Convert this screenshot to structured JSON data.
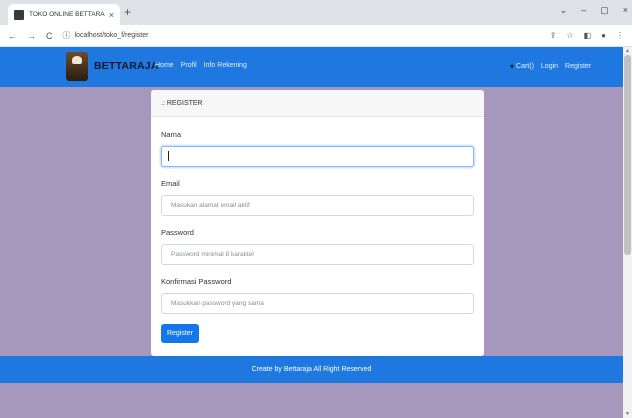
{
  "browser": {
    "tab_title": "TOKO ONLINE BETTARAJA",
    "tab_close": "×",
    "new_tab": "+",
    "url": "localhost/toko_f/register",
    "win_minimize": "–",
    "win_maximize": "▢",
    "win_close": "×",
    "win_chevron": "⌄"
  },
  "navbar": {
    "brand": "BETTARAJA",
    "links": [
      "Home",
      "Profil",
      "Info Rekening"
    ],
    "cart": "Cart()",
    "login": "Login",
    "register": "Register"
  },
  "card": {
    "header": ".: REGISTER",
    "fields": [
      {
        "label": "Nama",
        "value": "",
        "placeholder": ""
      },
      {
        "label": "Email",
        "value": "",
        "placeholder": "Masukan alamat email aktif"
      },
      {
        "label": "Password",
        "value": "",
        "placeholder": "Password minimal 8 karakter"
      },
      {
        "label": "Konfirmasi Password",
        "value": "",
        "placeholder": "Masukkan password yang sama"
      }
    ],
    "submit": "Register"
  },
  "footer": {
    "text": "Create by Bettaraja All Right Reserved"
  },
  "colors": {
    "page_bg": "#a697bd",
    "navbar": "#1e78e0",
    "button": "#1476e8"
  }
}
